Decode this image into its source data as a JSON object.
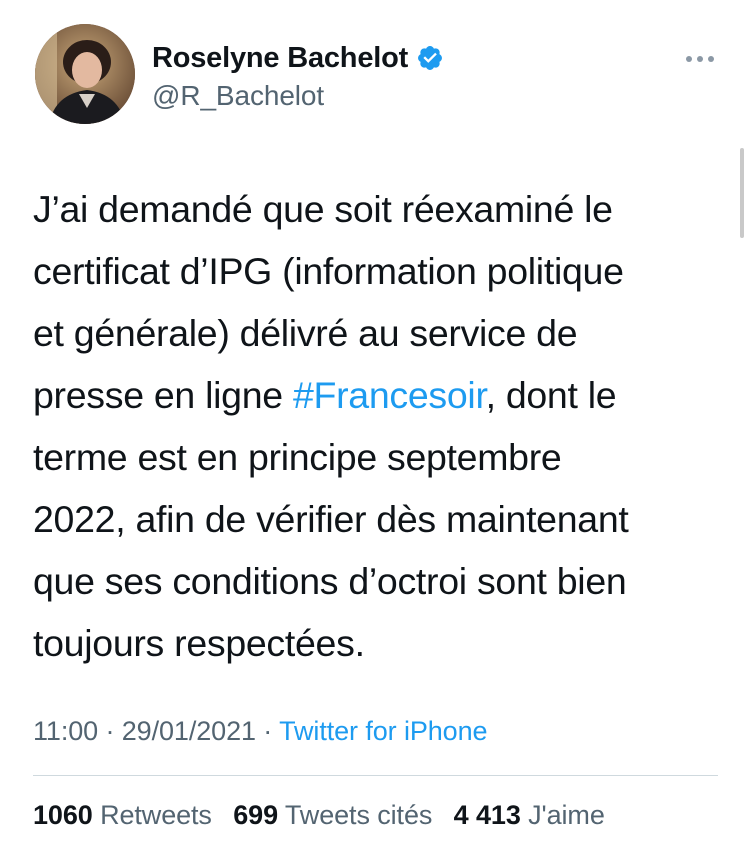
{
  "author": {
    "display_name": "Roselyne Bachelot",
    "handle": "@R_Bachelot",
    "verified": true,
    "avatar_icon": "profile-photo"
  },
  "more_icon": "ellipsis-icon",
  "tweet": {
    "line1": "J’ai demandé que soit réexaminé le",
    "line2": "certificat d’IPG (information politique",
    "line3": "et générale) délivré au service de",
    "line4_before": "presse en ligne ",
    "hashtag": "#Francesoir",
    "line4_after": ", dont le",
    "line5": "terme est en principe septembre",
    "line6": "2022, afin de vérifier dès maintenant",
    "line7": "que ses conditions d’octroi sont bien",
    "line8": "toujours respectées."
  },
  "meta": {
    "time": "11:00",
    "sep1": " · ",
    "date": "29/01/2021",
    "sep2": " · ",
    "source": "Twitter for iPhone"
  },
  "stats": {
    "retweets_count": "1060",
    "retweets_label": "Retweets",
    "quotes_count": "699",
    "quotes_label": "Tweets cités",
    "likes_count": "4 413",
    "likes_label": "J'aime"
  },
  "colors": {
    "link": "#1d9bf0",
    "secondary_text": "#536471",
    "primary_text": "#0f1419",
    "verified_badge": "#1d9bf0"
  }
}
